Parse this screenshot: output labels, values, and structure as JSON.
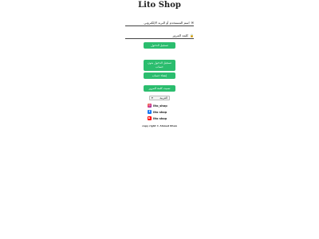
{
  "header": {
    "title": "Lito Shop"
  },
  "form": {
    "email_label": "اسم المستخدم أو البريد الإلكتروني",
    "email_value": "",
    "password_label": "كلمة المرور",
    "password_value": "",
    "login_button": "تسجيل الدخول"
  },
  "actions": {
    "login_no_account": "تسجيل الدخول بدون حساب",
    "create_account": "إنشاء حساب",
    "forgot_password": "نسيت كلمة المرور"
  },
  "language": {
    "selected": "العربية"
  },
  "social": [
    {
      "icon": "instagram-icon",
      "label": "lito_shop"
    },
    {
      "icon": "facebook-icon",
      "label": "lito shop"
    },
    {
      "icon": "youtube-icon",
      "label": "lito shop"
    }
  ],
  "footer": {
    "copyright": "copy right © Ahmed Khan"
  },
  "colors": {
    "accent": "#2bbd6e"
  }
}
